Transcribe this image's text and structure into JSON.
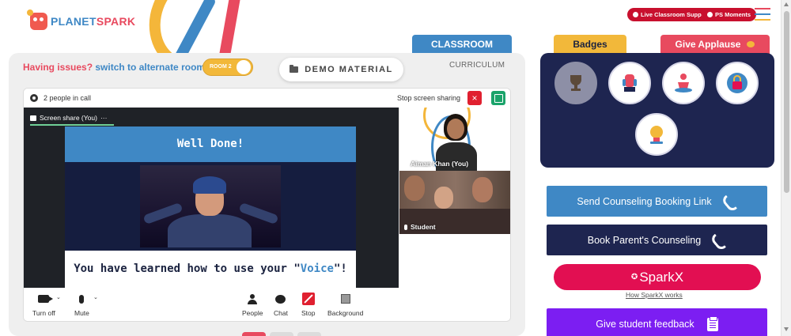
{
  "brand": {
    "logo_prefix": "PLANET",
    "logo_suffix": "SPARK"
  },
  "top_pills": {
    "live_support": "Live Classroom Support",
    "ps_moments": "PS Moments"
  },
  "tabs": {
    "classroom": "CLASSROOM",
    "curriculum": "CURRICULUM",
    "badges": "Badges",
    "give_applause": "Give Applause"
  },
  "issues": {
    "prefix": "Having issues?",
    "link": "switch to alternate room"
  },
  "room_toggle": {
    "label": "ROOM 2"
  },
  "demo_material": "DEMO MATERIAL",
  "meet": {
    "people_count": "2 people in call",
    "stop_sharing": "Stop screen sharing",
    "share_tab": "Screen share (You)",
    "slide": {
      "title": "Well Done!",
      "caption_prefix": "You have learned how to use your \"",
      "caption_highlight": "Voice",
      "caption_suffix": "\"!"
    },
    "tiles": [
      {
        "name": "Aiman Khan (You)"
      },
      {
        "name": "Student"
      }
    ],
    "toolbar": {
      "turn_off": "Turn off",
      "mute": "Mute",
      "people": "People",
      "chat": "Chat",
      "stop": "Stop",
      "background": "Background"
    }
  },
  "right": {
    "send_counseling": "Send Counseling Booking Link",
    "book_parent": "Book Parent's Counseling",
    "sparkx": "SparkX",
    "sparkx_link": "How SparkX works",
    "feedback": "Give student feedback"
  },
  "colors": {
    "blue": "#3f88c5",
    "navy": "#1e2550",
    "red": "#e84a5f",
    "yellow": "#f2b83a",
    "sparkx": "#e20f52",
    "purple": "#7c1ef2"
  }
}
